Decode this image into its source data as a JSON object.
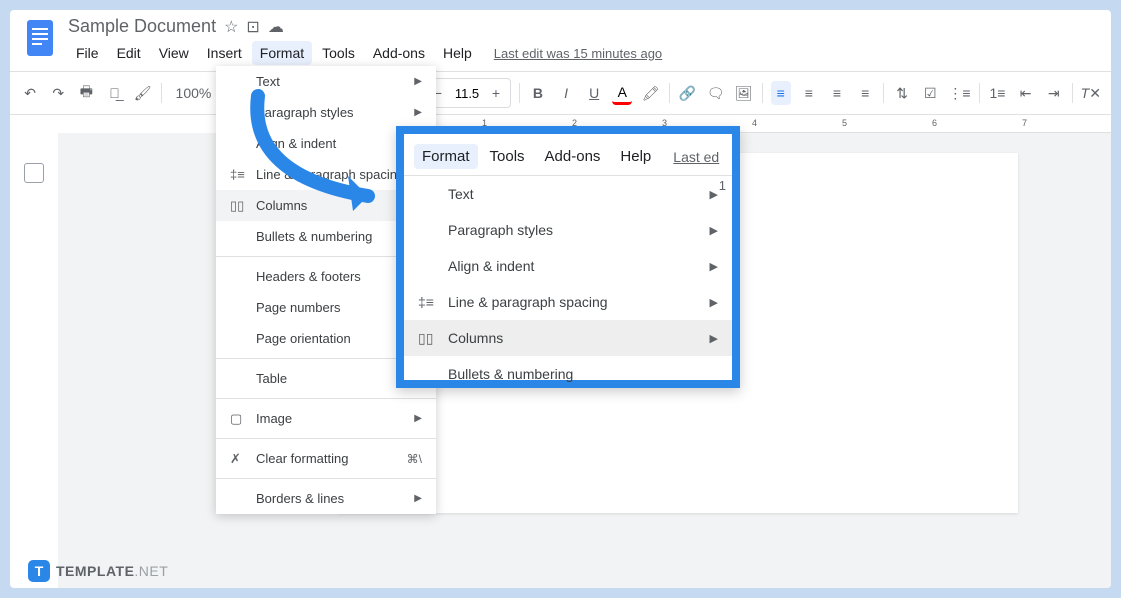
{
  "doc": {
    "title": "Sample Document"
  },
  "menubar": {
    "file": "File",
    "edit": "Edit",
    "view": "View",
    "insert": "Insert",
    "format": "Format",
    "tools": "Tools",
    "addons": "Add-ons",
    "help": "Help",
    "last_edit": "Last edit was 15 minutes ago"
  },
  "toolbar": {
    "zoom": "100%",
    "font_size": "11.5"
  },
  "dropdown": {
    "text": "Text",
    "paragraph_styles": "Paragraph styles",
    "align_indent": "Align & indent",
    "line_spacing": "Line & paragraph spacing",
    "columns": "Columns",
    "bullets": "Bullets & numbering",
    "headers": "Headers & footers",
    "page_numbers": "Page numbers",
    "page_orientation": "Page orientation",
    "table": "Table",
    "image": "Image",
    "clear_formatting": "Clear formatting",
    "clear_shortcut": "⌘\\",
    "borders": "Borders & lines"
  },
  "callout": {
    "format": "Format",
    "tools": "Tools",
    "addons": "Add-ons",
    "help": "Help",
    "last_edit": "Last ed",
    "side": "1",
    "text": "Text",
    "paragraph_styles": "Paragraph styles",
    "align_indent": "Align & indent",
    "line_spacing": "Line & paragraph spacing",
    "columns": "Columns",
    "bullets": "Bullets & numbering"
  },
  "ruler": {
    "n1": "1",
    "n2": "2",
    "n3": "3",
    "n4": "4",
    "n5": "5",
    "n6": "6",
    "n7": "7"
  },
  "brand": {
    "name": "TEMPLATE",
    "suffix": ".NET",
    "icon": "T"
  }
}
